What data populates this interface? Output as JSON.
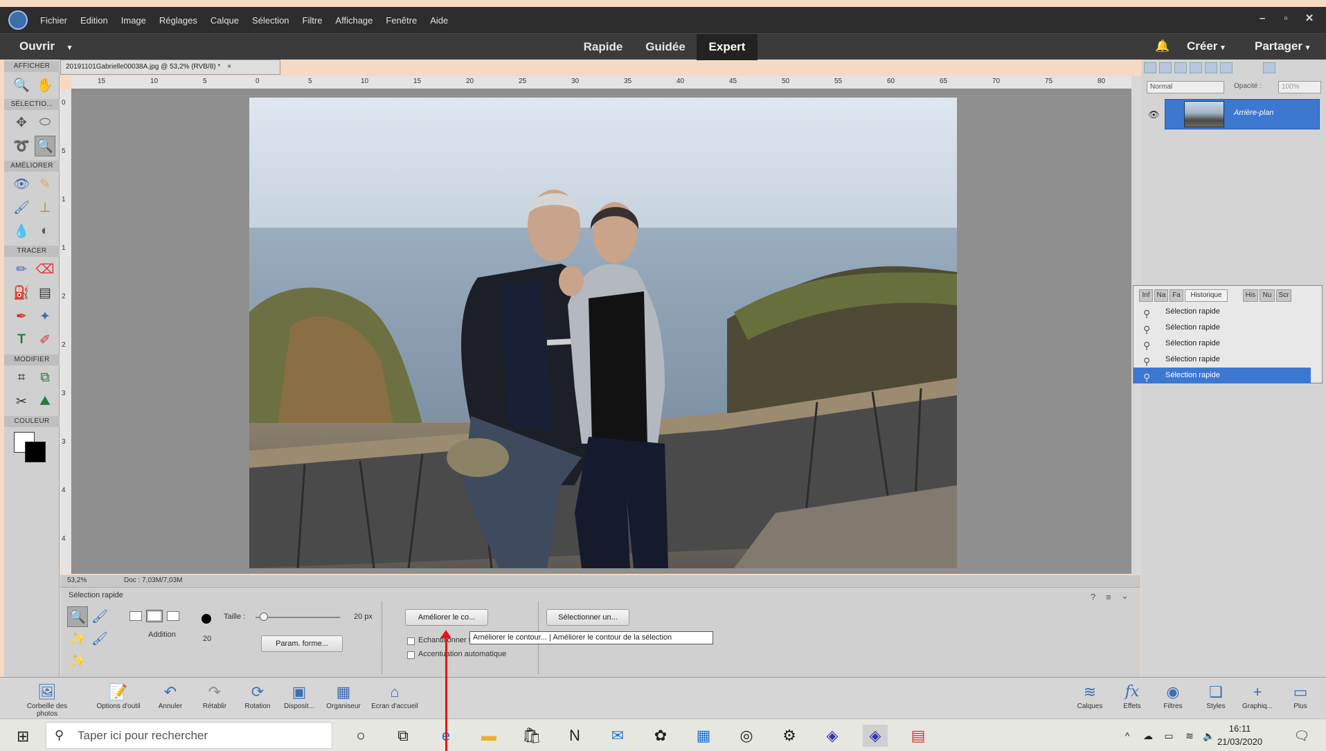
{
  "menubar": {
    "items": [
      "Fichier",
      "Edition",
      "Image",
      "Réglages",
      "Calque",
      "Sélection",
      "Filtre",
      "Affichage",
      "Fenêtre",
      "Aide"
    ]
  },
  "modebar": {
    "open_label": "Ouvrir",
    "tabs": [
      "Rapide",
      "Guidée",
      "Expert"
    ],
    "active_tab": "Expert",
    "create_label": "Créer",
    "share_label": "Partager"
  },
  "tool_sections": {
    "view": "AFFICHER",
    "select": "SÉLECTIO...",
    "enhance": "AMÉLIORER",
    "draw": "TRACER",
    "modify": "MODIFIER",
    "color": "COULEUR"
  },
  "document": {
    "tab_title": "20191101Gabrielle00038A.jpg @ 53,2% (RVB/8) *",
    "close": "×",
    "zoom": "53,2%",
    "doc_info": "Doc : 7,03M/7,03M"
  },
  "rulers": {
    "h": [
      "15",
      "10",
      "5",
      "0",
      "5",
      "10",
      "15",
      "20",
      "25",
      "30",
      "35",
      "40",
      "45",
      "50",
      "55",
      "60",
      "65",
      "70",
      "75",
      "80"
    ],
    "v": [
      "0",
      "5",
      "1",
      "1",
      "2",
      "2",
      "3",
      "3",
      "4",
      "4"
    ]
  },
  "layers": {
    "blend_mode": "Normal",
    "opacity_label": "Opacité :",
    "opacity_value": "100%",
    "layer_name": "Arrière-plan"
  },
  "history": {
    "tabs": [
      "Inf",
      "Na",
      "Fa",
      "Historique",
      "His",
      "Nu",
      "Scr"
    ],
    "items": [
      "Sélection rapide",
      "Sélection rapide",
      "Sélection rapide",
      "Sélection rapide",
      "Sélection rapide"
    ]
  },
  "tool_options": {
    "title": "Sélection rapide",
    "mode_label": "Addition",
    "size_label": "Taille :",
    "size_value": "20 px",
    "brush_size": "20",
    "size_level": 0.1,
    "brush_settings_btn": "Param. forme...",
    "refine_btn": "Améliorer le co...",
    "select_subject_btn": "Sélectionner un...",
    "sample_all_label": "Echantillonner tous les calques",
    "auto_enhance_label": "Accentuation automatique",
    "tooltip": "Améliorer le contour... | Améliorer le contour de la sélection"
  },
  "taskpanel": {
    "left": [
      "Corbeille des photos",
      "Options d'outil",
      "Annuler",
      "Rétablir",
      "Rotation",
      "Disposit...",
      "Organiseur",
      "Ecran d'accueil"
    ],
    "right": [
      "Calques",
      "Effets",
      "Filtres",
      "Styles",
      "Graphiq...",
      "Plus"
    ]
  },
  "windows": {
    "search_placeholder": "Taper ici pour rechercher",
    "time": "16:11",
    "date": "21/03/2020"
  },
  "colors": {
    "accent": "#3d78d0",
    "arrow": "#e11111",
    "app_bg": "#2d2d2d"
  }
}
